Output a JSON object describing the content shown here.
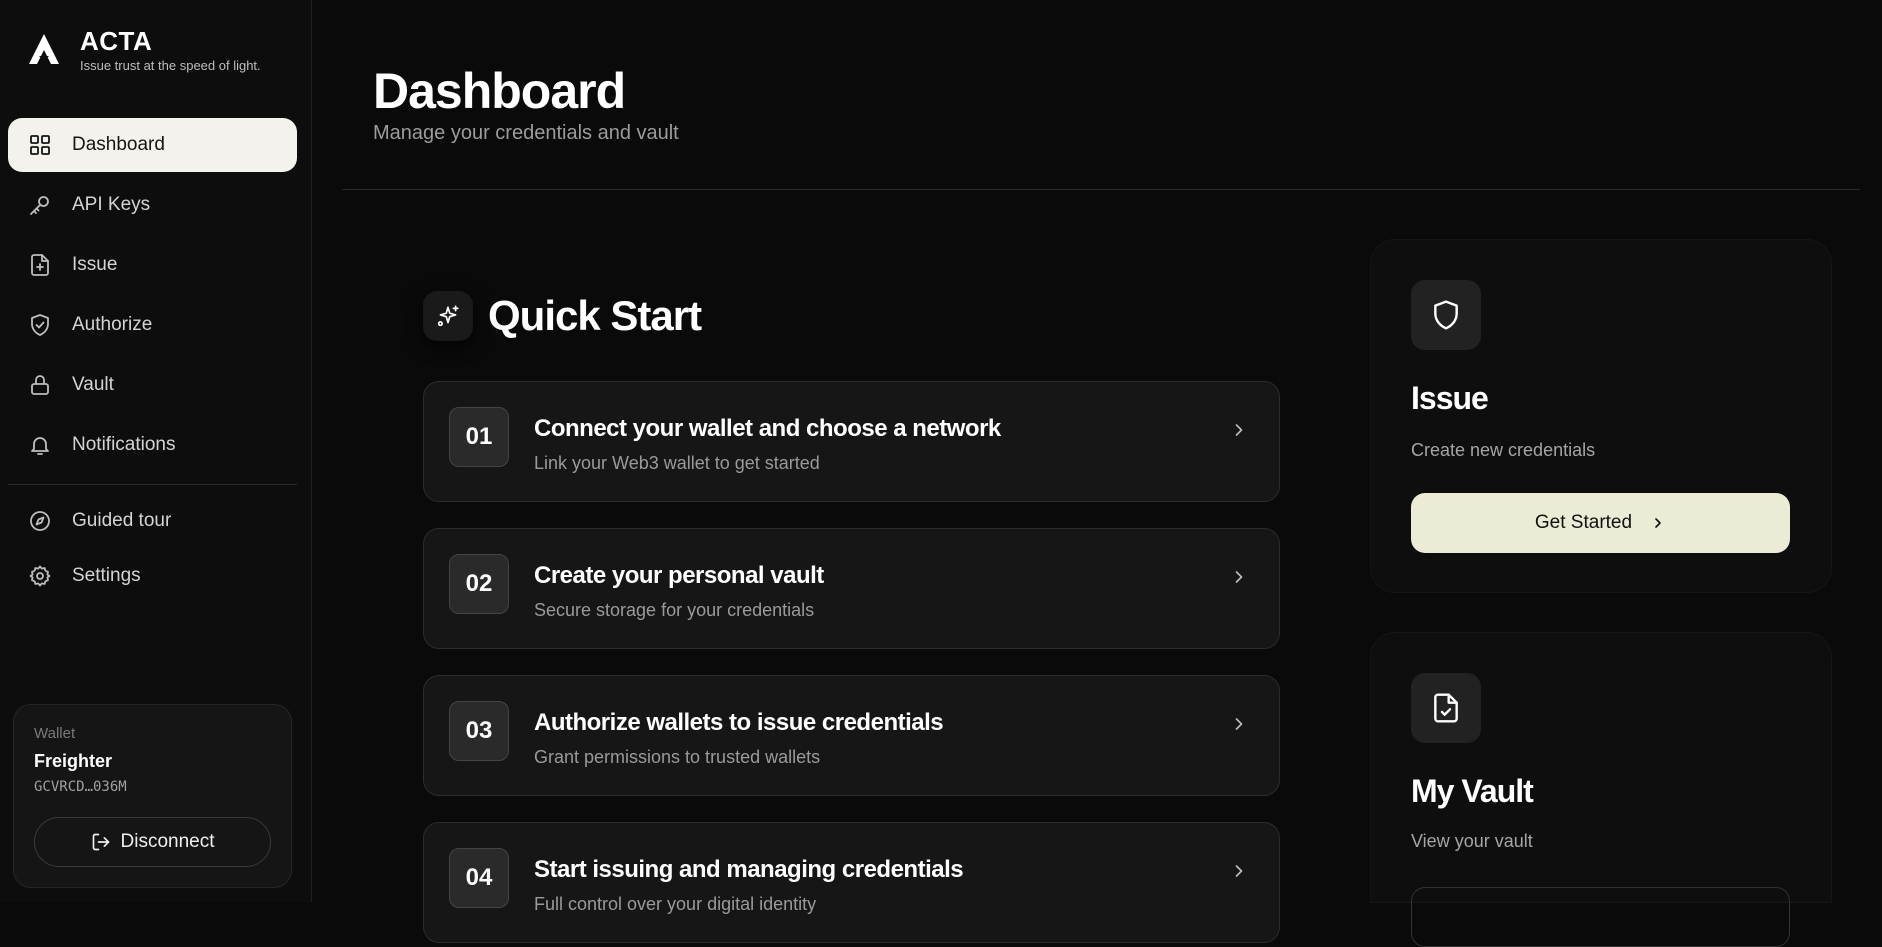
{
  "brand": {
    "name": "ACTA",
    "tagline": "Issue trust at the speed of light."
  },
  "sidebar": {
    "items": [
      {
        "label": "Dashboard",
        "icon": "grid-icon",
        "active": true
      },
      {
        "label": "API Keys",
        "icon": "key-icon"
      },
      {
        "label": "Issue",
        "icon": "file-plus-icon"
      },
      {
        "label": "Authorize",
        "icon": "shield-check-icon"
      },
      {
        "label": "Vault",
        "icon": "lock-icon"
      },
      {
        "label": "Notifications",
        "icon": "bell-icon"
      }
    ],
    "secondary": [
      {
        "label": "Guided tour",
        "icon": "compass-icon"
      },
      {
        "label": "Settings",
        "icon": "gear-icon"
      }
    ]
  },
  "wallet": {
    "label": "Wallet",
    "name": "Freighter",
    "address": "GCVRCD…036M",
    "disconnect_label": "Disconnect"
  },
  "header": {
    "title": "Dashboard",
    "subtitle": "Manage your credentials and vault"
  },
  "quick_start": {
    "title": "Quick Start",
    "steps": [
      {
        "num": "01",
        "title": "Connect your wallet and choose a network",
        "desc": "Link your Web3 wallet to get started"
      },
      {
        "num": "02",
        "title": "Create your personal vault",
        "desc": "Secure storage for your credentials"
      },
      {
        "num": "03",
        "title": "Authorize wallets to issue credentials",
        "desc": "Grant permissions to trusted wallets"
      },
      {
        "num": "04",
        "title": "Start issuing and managing credentials",
        "desc": "Full control over your digital identity"
      }
    ]
  },
  "cards": {
    "issue": {
      "title": "Issue",
      "desc": "Create new credentials",
      "cta": "Get Started"
    },
    "vault": {
      "title": "My Vault",
      "desc": "View your vault"
    }
  },
  "colors": {
    "accent": "#ecebd6",
    "background": "#0a0a0a",
    "active_nav": "#f4f2ec"
  }
}
